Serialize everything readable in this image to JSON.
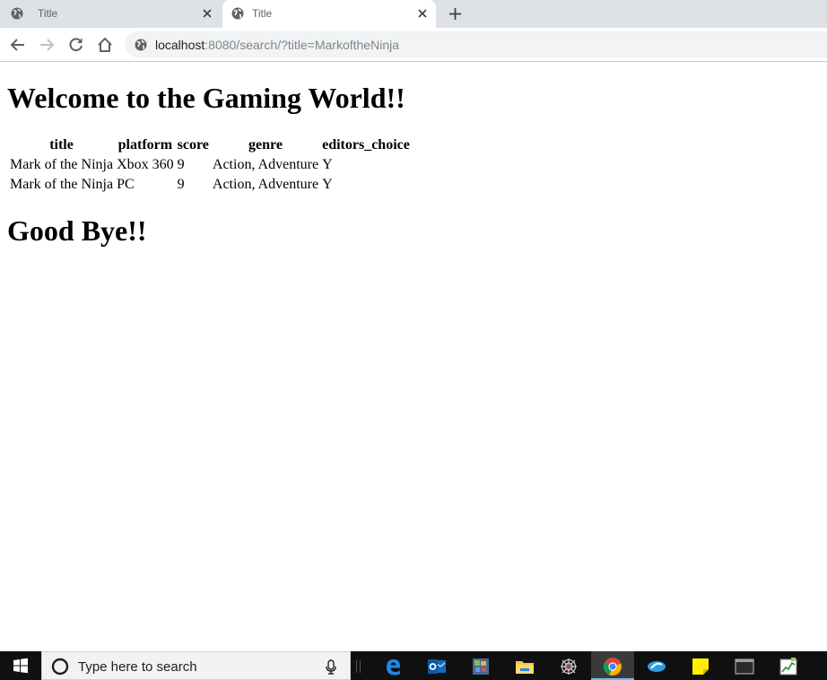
{
  "browser": {
    "tabs": [
      {
        "title": "Title",
        "active": false
      },
      {
        "title": "Title",
        "active": true
      }
    ],
    "address_bar": {
      "host": "localhost",
      "rest": ":8080/search/?title=MarkoftheNinja"
    }
  },
  "page": {
    "heading": "Welcome to the Gaming World!!",
    "table": {
      "headers": [
        "title",
        "platform",
        "score",
        "genre",
        "editors_choice"
      ],
      "rows": [
        [
          "Mark of the Ninja",
          "Xbox 360",
          "9",
          "Action, Adventure",
          "Y"
        ],
        [
          "Mark of the Ninja",
          "PC",
          "9",
          "Action, Adventure",
          "Y"
        ]
      ]
    },
    "footer_heading": "Good Bye!!"
  },
  "taskbar": {
    "search_placeholder": "Type here to search",
    "apps": [
      "edge-icon",
      "outlook-icon",
      "photos-icon",
      "file-explorer-icon",
      "spider-icon",
      "chrome-icon",
      "remote-icon",
      "sticky-notes-icon",
      "terminal-icon",
      "task-manager-icon"
    ]
  },
  "colors": {
    "tabstrip": "#dee1e6",
    "taskbar": "#101010",
    "taskbar_active_indicator": "#76b9ed"
  }
}
